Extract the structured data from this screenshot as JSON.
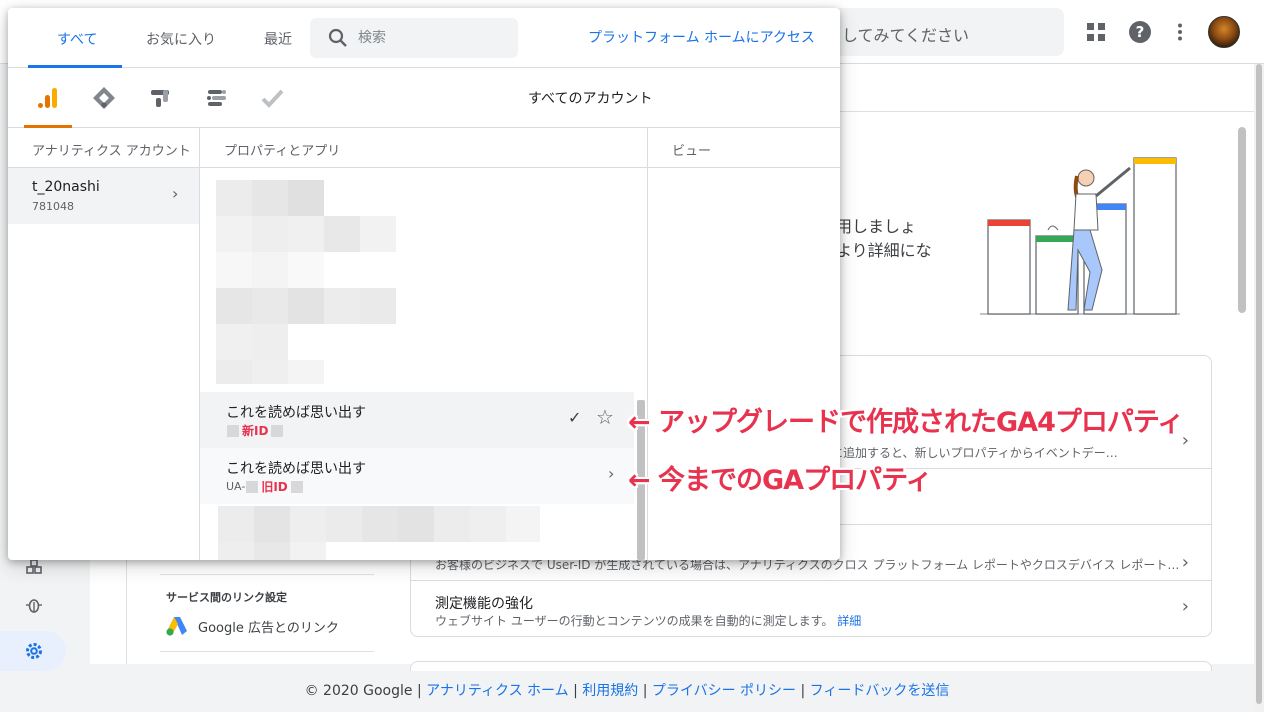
{
  "background": {
    "search_placeholder": "してみてください",
    "promo_line_1": "活用しましょ",
    "promo_line_2": "ぐより詳細にな",
    "cards": [
      {
        "desc": "プリに追加すると、新しいプロパティからイベントデー…"
      },
      {
        "desc": "お客様のビジネスで User-ID が生成されている場合は、アナリティクスのクロス プラットフォーム レポートやクロスデバイス レポート…"
      },
      {
        "title": "測定機能の強化",
        "desc": "ウェブサイト ユーザーの行動とコンテンツの成果を自動的に測定します。",
        "link": "詳細"
      }
    ],
    "link_section": {
      "heading": "サービス間のリンク設定",
      "item": "Google 広告とのリンク"
    }
  },
  "footer": {
    "copyright": "© 2020 Google",
    "links": [
      "アナリティクス ホーム",
      "利用規約",
      "プライバシー ポリシー",
      "フィードバックを送信"
    ],
    "separator": " | "
  },
  "popup": {
    "tabs": [
      {
        "label": "すべて",
        "active": true
      },
      {
        "label": "お気に入り",
        "active": false
      },
      {
        "label": "最近",
        "active": false
      }
    ],
    "search_placeholder": "検索",
    "platform_link": "プラットフォーム ホームにアクセス",
    "products": [
      "analytics-icon",
      "tag-manager-icon",
      "optimize-icon",
      "data-studio-icon",
      "surveys-icon"
    ],
    "all_accounts": "すべてのアカウント",
    "columns": {
      "accounts": "アナリティクス アカウント",
      "properties": "プロパティとアプリ",
      "views": "ビュー"
    },
    "account": {
      "name": "t_20nashi",
      "id": "781048"
    },
    "properties": [
      {
        "name": "これを読めば思い出す",
        "id_label": "新ID",
        "id_prefix": "",
        "selected": true
      },
      {
        "name": "これを読めば思い出す",
        "id_label": "旧ID",
        "id_prefix": "UA-",
        "selected": false
      }
    ]
  },
  "annotations": {
    "ga4": "← アップグレードで作成されたGA4プロパティ",
    "ua": "← 今までのGAプロパティ"
  },
  "colors": {
    "accent": "#1a73e8",
    "analytics": "#e37400",
    "annotation": "#e8334f"
  }
}
